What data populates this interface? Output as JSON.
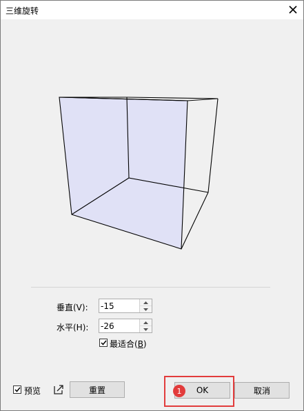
{
  "window": {
    "title": "三维旋转"
  },
  "fields": {
    "vertical": {
      "label": "垂直(V):",
      "value": "-15"
    },
    "horizontal": {
      "label": "水平(H):",
      "value": "-26"
    }
  },
  "best_fit": {
    "label_main": "最适合(",
    "label_key": "B",
    "label_end": ")",
    "checked": true
  },
  "bottom": {
    "preview_label": "预览",
    "reset_label": "重置",
    "ok_label": "OK",
    "cancel_label": "取消"
  },
  "annotation": {
    "step": "1",
    "color": "#e23b3b"
  },
  "colors": {
    "face_fill": "#e0e1f6",
    "edge": "#000000"
  }
}
